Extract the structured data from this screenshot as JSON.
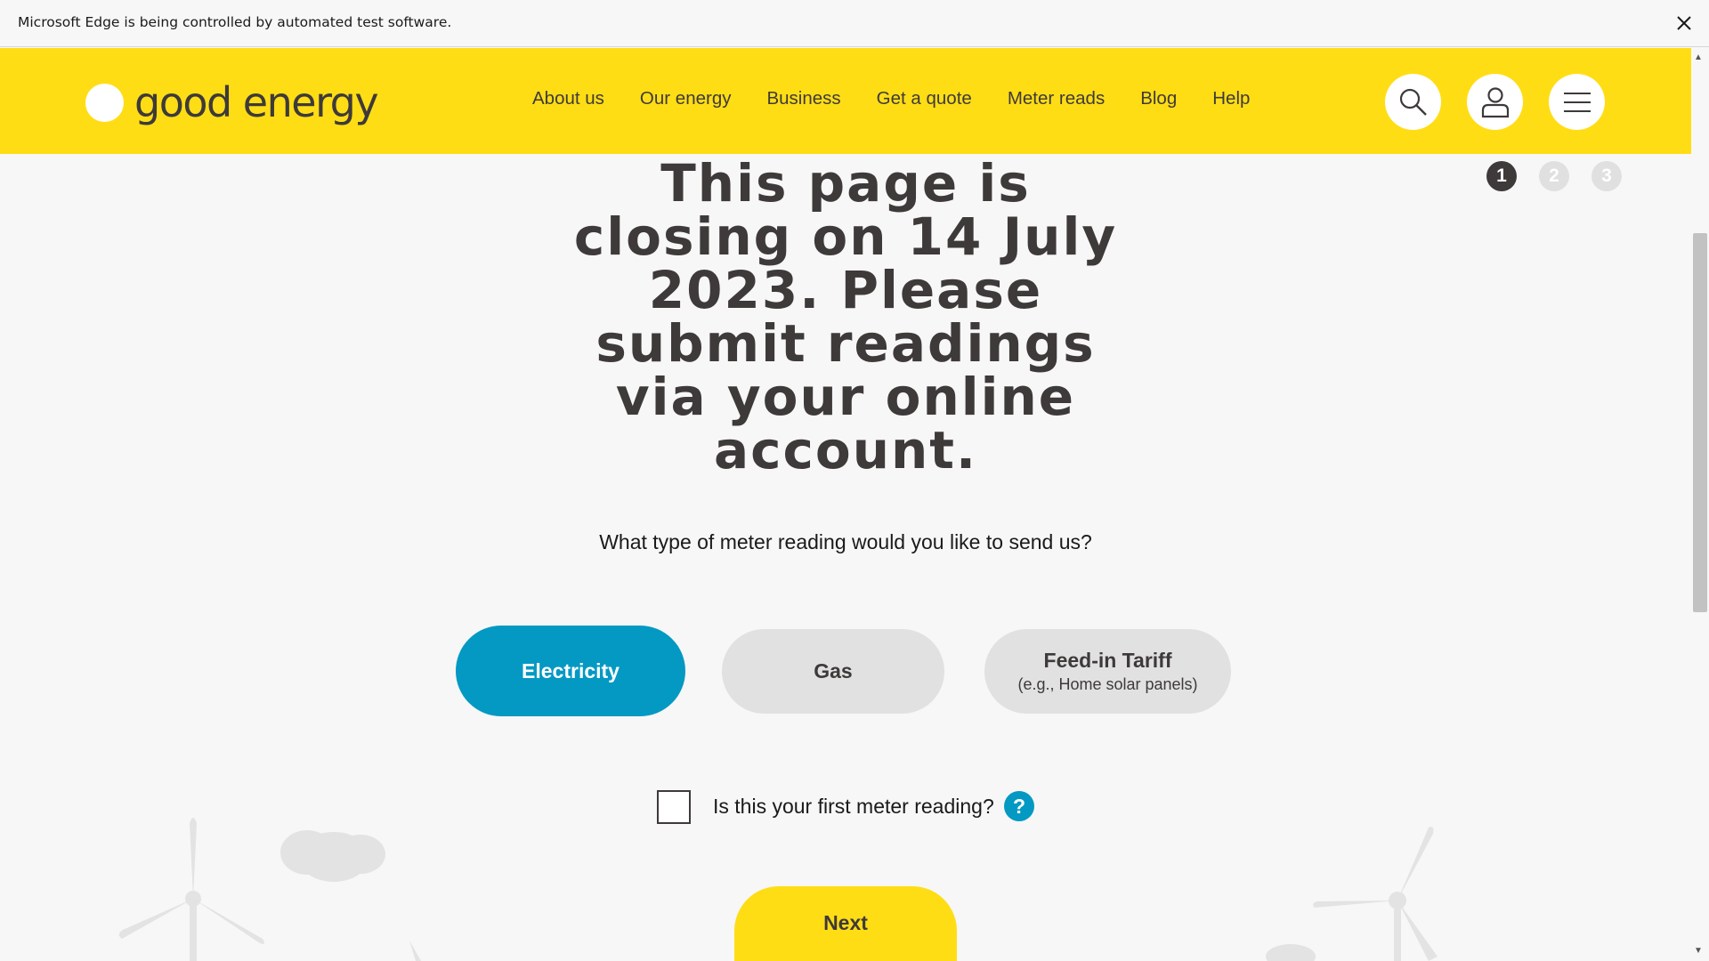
{
  "infobar": {
    "message": "Microsoft Edge is being controlled by automated test software."
  },
  "header": {
    "logo_text": "good energy",
    "nav": [
      "About us",
      "Our energy",
      "Business",
      "Get a quote",
      "Meter reads",
      "Blog",
      "Help"
    ],
    "icons": [
      "search-icon",
      "account-icon",
      "menu-icon"
    ]
  },
  "steps": {
    "items": [
      "1",
      "2",
      "3"
    ],
    "active": "1",
    "active_color": "#3e3a39",
    "inactive_color": "#e0e0e0"
  },
  "main": {
    "heading": "This page is closing on 14 July 2023. Please submit readings via your online account.",
    "question": "What type of meter reading would you like to send us?",
    "options": [
      {
        "label": "Electricity",
        "selected": true
      },
      {
        "label": "Gas",
        "selected": false
      },
      {
        "label": "Feed-in Tariff",
        "sublabel": "(e.g., Home solar panels)",
        "selected": false
      }
    ],
    "first_reading_label": "Is this your first meter reading?",
    "first_reading_checked": false,
    "help_label": "?",
    "next_label": "Next"
  },
  "colors": {
    "brand_yellow": "#ffdd15",
    "accent_blue": "#0399c3",
    "text_dark": "#3e3a39",
    "pill_grey": "#e1e1e1"
  }
}
